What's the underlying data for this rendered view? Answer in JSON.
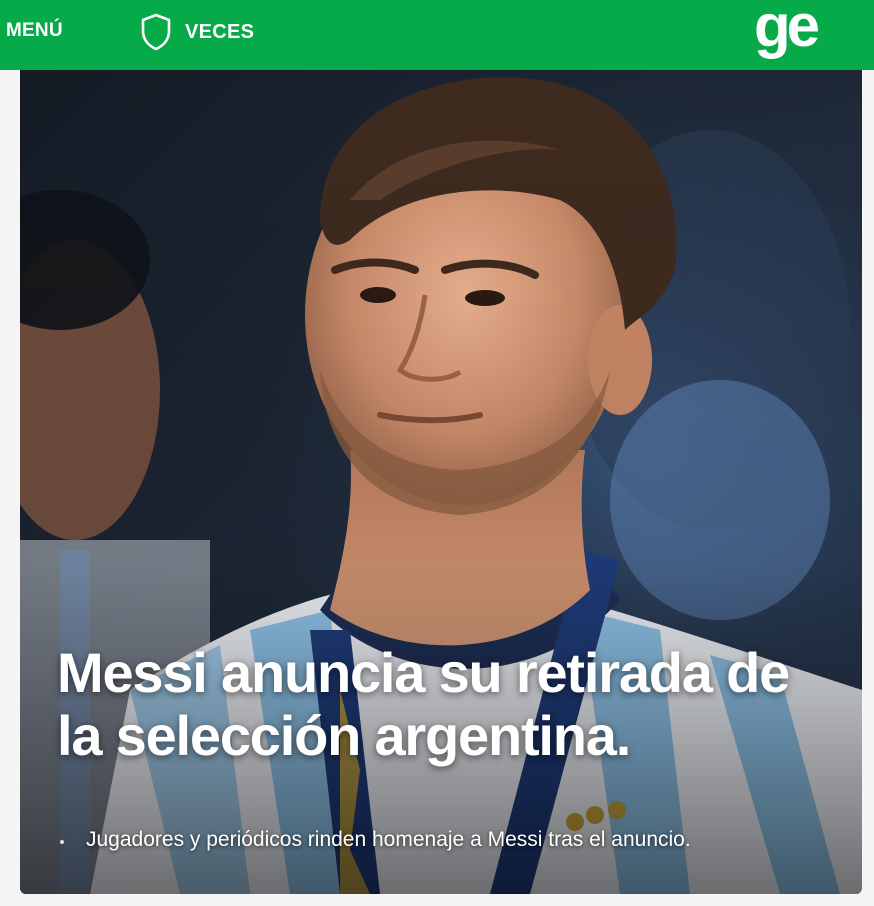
{
  "header": {
    "menu_label": "MENÚ",
    "team_label": "VECES",
    "logo_text": "ge",
    "brand_color": "#06aa48"
  },
  "hero": {
    "headline": "Messi anuncia su retirada de la selección argentina.",
    "related": [
      {
        "text": "Jugadores y periódicos rinden homenaje a Messi tras el anuncio."
      }
    ]
  },
  "icons": {
    "team": "shield-icon",
    "logo": "ge-logo",
    "bullet": "bullet-icon"
  }
}
